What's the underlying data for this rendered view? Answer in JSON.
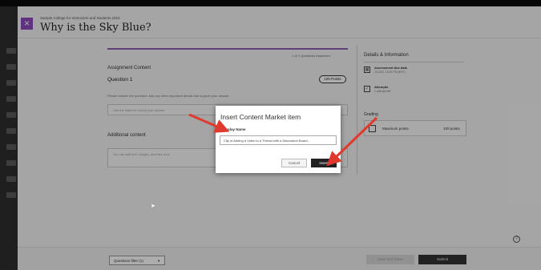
{
  "header": {
    "breadcrumb": "Sample College for Instructors and Students 2016",
    "title": "Why is the Sky Blue?",
    "close_icon": "×"
  },
  "assignment": {
    "progress_label": "1 of 1 Questions Answered",
    "content_heading": "Assignment Content",
    "question_title": "Question 1",
    "points_badge": "100 Points",
    "question_text": "Please answer the question. Add any other important details that support your answer.",
    "answer_placeholder": "Use the editor to format your answer",
    "additional_heading": "Additional content",
    "additional_placeholder": "You can add text, images, and files here"
  },
  "details": {
    "title": "Details & Information",
    "due_label": "Assessment due date",
    "due_value": "2/14/22, 12:00 PM (EST)",
    "attempts_label": "Attempts",
    "attempts_value": "1 attempt left",
    "grading_label": "Grading",
    "grading_max_label": "Maximum points",
    "grading_points": "100 points"
  },
  "footer": {
    "question_filter": "Questions filter (1)",
    "filter_chevron": "▾",
    "save_close": "Save and Close",
    "submit": "Submit",
    "help_icon": "?"
  },
  "modal": {
    "title": "Insert Content Market item",
    "display_name_label": "Display Name",
    "display_name_value": "Clip of Adding a Video to a Thread with a Discussion Board...",
    "cancel": "Cancel",
    "insert": "Insert"
  },
  "colors": {
    "accent": "#8b4bbd",
    "arrow": "#e03a2f"
  }
}
